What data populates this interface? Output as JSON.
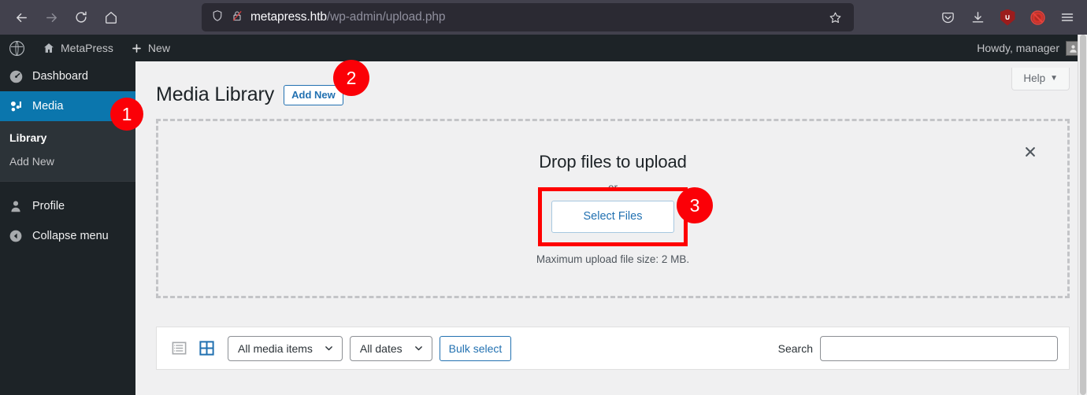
{
  "browser": {
    "nav": [
      {
        "name": "back",
        "icon": "arrow-left-icon"
      },
      {
        "name": "forward",
        "icon": "arrow-right-icon"
      },
      {
        "name": "reload",
        "icon": "reload-icon"
      },
      {
        "name": "home",
        "icon": "home-icon"
      }
    ],
    "url": {
      "host": "metapress.htb",
      "path": "/wp-admin/upload.php",
      "shield_icon": "shield-icon",
      "lock_broken_icon": "lock-broken-icon",
      "bookmark_icon": "star-icon"
    },
    "toolbar_icons": [
      {
        "name": "pocket-icon",
        "label": ""
      },
      {
        "name": "download-icon",
        "label": ""
      },
      {
        "name": "ublock-origin-icon",
        "label": "∪"
      },
      {
        "name": "adblock-disabled-icon",
        "label": ""
      },
      {
        "name": "menu-hamburger-icon",
        "label": ""
      }
    ]
  },
  "adminbar": {
    "wp_logo": "wordpress-logo-icon",
    "site_name": "MetaPress",
    "site_icon": "home-icon",
    "new_label": "New",
    "new_icon": "plus-icon",
    "howdy": "Howdy, manager",
    "avatar": "avatar-icon"
  },
  "sidebar": {
    "items": [
      {
        "label": "Dashboard",
        "icon": "dashboard-icon",
        "active": false
      },
      {
        "label": "Media",
        "icon": "media-icon",
        "active": true
      }
    ],
    "submenu": [
      {
        "label": "Library",
        "current": true
      },
      {
        "label": "Add New",
        "current": false
      }
    ],
    "bottom": [
      {
        "label": "Profile",
        "icon": "user-icon"
      },
      {
        "label": "Collapse menu",
        "icon": "collapse-arrow-icon"
      }
    ]
  },
  "page": {
    "title": "Media Library",
    "add_new_label": "Add New",
    "help_label": "Help",
    "help_caret": "▼"
  },
  "dropzone": {
    "title": "Drop files to upload",
    "or_label": "or",
    "select_files_label": "Select Files",
    "max_size_note": "Maximum upload file size: 2 MB.",
    "close_icon": "close-x-icon"
  },
  "media_toolbar": {
    "list_view_icon": "list-view-icon",
    "grid_view_icon": "grid-view-icon",
    "filter_media": "All media items",
    "filter_dates": "All dates",
    "bulk_select_label": "Bulk select",
    "caret": "⌄",
    "search_label": "Search",
    "search_value": "",
    "search_placeholder": ""
  },
  "annotations": [
    {
      "id": 1,
      "label": "1",
      "target": "sidebar-media"
    },
    {
      "id": 2,
      "label": "2",
      "target": "add-new-button"
    },
    {
      "id": 3,
      "label": "3",
      "target": "select-files-button"
    }
  ],
  "colors": {
    "wp_blue": "#0b76ad",
    "link_blue": "#2271b1",
    "annotation_red": "#fb0007",
    "admin_dark": "#1d2327",
    "page_bg": "#f0f0f1"
  }
}
